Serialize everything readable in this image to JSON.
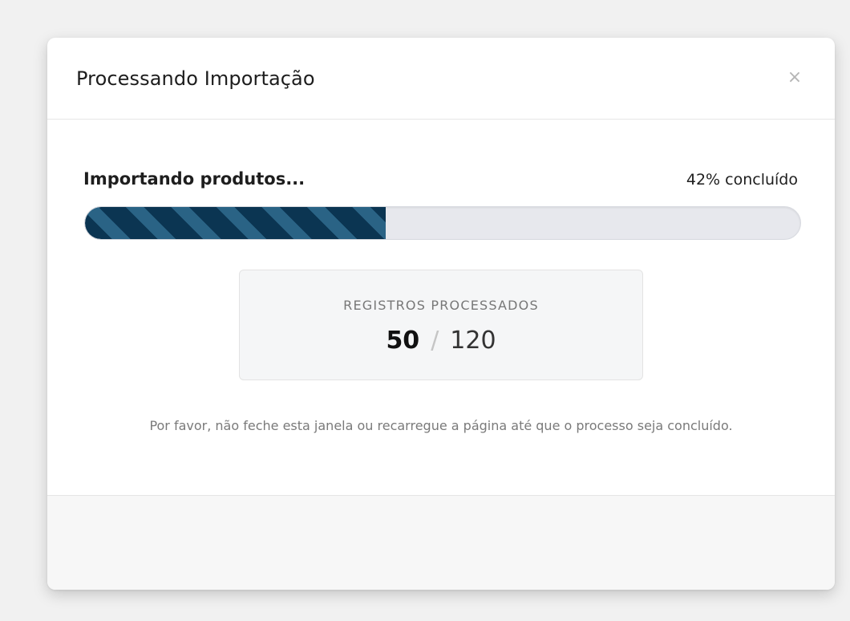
{
  "modal": {
    "title": "Processando Importação",
    "close_icon": "close-icon",
    "close_glyph": "×"
  },
  "progress": {
    "label": "Importando produtos...",
    "percent_text": "42% concluído",
    "value": 0.42,
    "fill_color": "#0b3552",
    "stripe_color": "#2a6385"
  },
  "counter": {
    "label": "REGISTROS PROCESSADOS",
    "current": "50",
    "separator": "/",
    "total": "120"
  },
  "notice": "Por favor, não feche esta janela ou recarregue a página até que o processo seja concluído."
}
